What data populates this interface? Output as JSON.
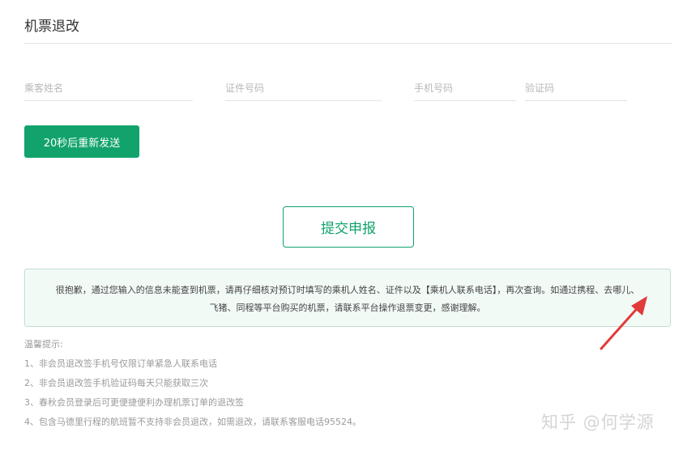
{
  "page": {
    "title": "机票退改"
  },
  "form": {
    "passenger_name_placeholder": "乘客姓名",
    "id_number_placeholder": "证件号码",
    "phone_placeholder": "手机号码",
    "verify_code_placeholder": "验证码",
    "resend_button_label": "20秒后重新发送",
    "submit_button_label": "提交申报"
  },
  "notice": {
    "line1": "很抱歉，通过您输入的信息未能查到机票，请再仔细核对预订时填写的乘机人姓名、证件以及【乘机人联系电话】，再次查询。如通过携程、去哪儿、",
    "line2": "飞猪、同程等平台购买的机票，请联系平台操作退票变更，感谢理解。"
  },
  "tips": {
    "heading": "温馨提示:",
    "items": [
      "1、非会员退改签手机号仅限订单紧急人联系电话",
      "2、非会员退改签手机验证码每天只能获取三次",
      "3、春秋会员登录后可更便捷便利办理机票订单的退改签",
      "4、包含马德里行程的航班暂不支持非会员退改，如需退改，请联系客服电话95524。"
    ]
  },
  "watermark": {
    "text": "知乎 @何学源"
  },
  "colors": {
    "brand_green": "#11a36b",
    "notice_border": "#bfe0cf",
    "notice_background": "#f2faf6",
    "annotation_arrow": "#e03a3a"
  }
}
